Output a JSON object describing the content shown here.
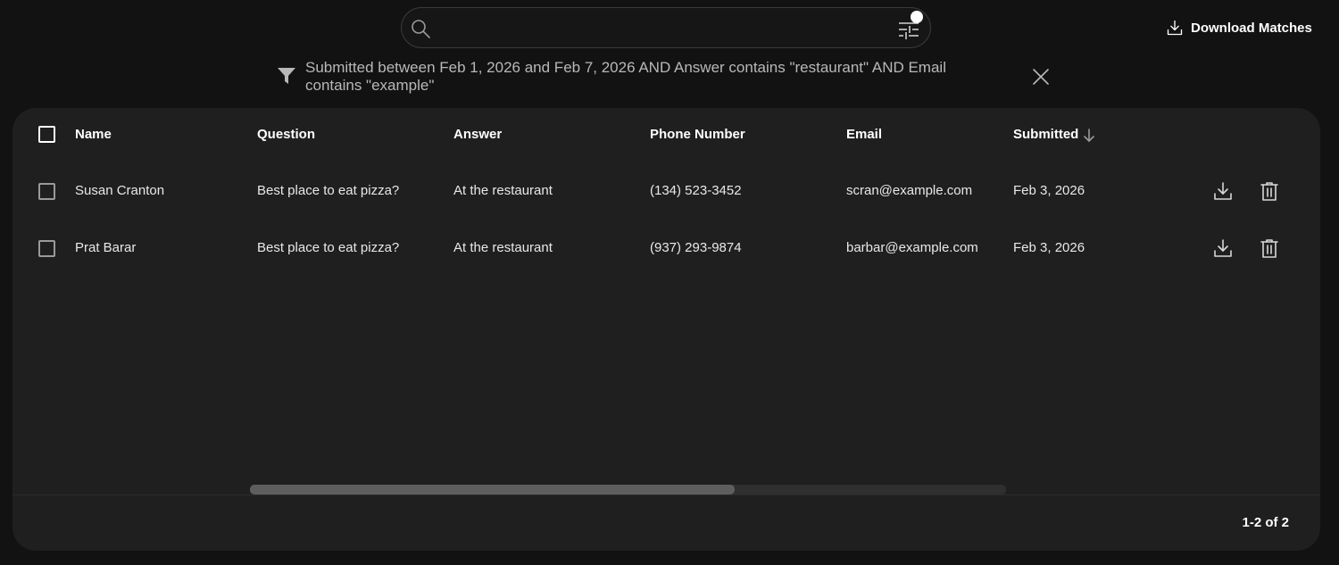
{
  "search": {
    "value": "",
    "placeholder": "",
    "icon": "search-icon",
    "filter_options_icon": "tune-icon"
  },
  "toolbar": {
    "download_matches_label": "Download Matches",
    "download_icon": "download-icon"
  },
  "active_filter": {
    "icon": "filter-icon",
    "text": "Submitted between Feb 1, 2026 and Feb 7, 2026 AND Answer contains \"restaurant\" AND Email contains \"example\"",
    "clear_icon": "close-icon"
  },
  "table": {
    "columns": [
      "Name",
      "Question",
      "Answer",
      "Phone Number",
      "Email",
      "Submitted"
    ],
    "sorted_column": "Submitted",
    "sort_direction": "descending",
    "rows": [
      {
        "name": "Susan Cranton",
        "question": "Best place to eat pizza?",
        "answer": "At the restaurant",
        "phone": "(134) 523-3452",
        "email": "scran@example.com",
        "submitted": "Feb 3, 2026"
      },
      {
        "name": "Prat Barar",
        "question": "Best place to eat pizza?",
        "answer": "At the restaurant",
        "phone": "(937) 293-9874",
        "email": "barbar@example.com",
        "submitted": "Feb 3, 2026"
      }
    ],
    "row_action_icons": [
      "download-icon",
      "trash-icon"
    ]
  },
  "pagination": {
    "label": "1-2 of 2"
  },
  "colors": {
    "background": "#121212",
    "card": "#1f1f1f",
    "text": "#ffffff",
    "muted_text": "#b8b8b8"
  }
}
